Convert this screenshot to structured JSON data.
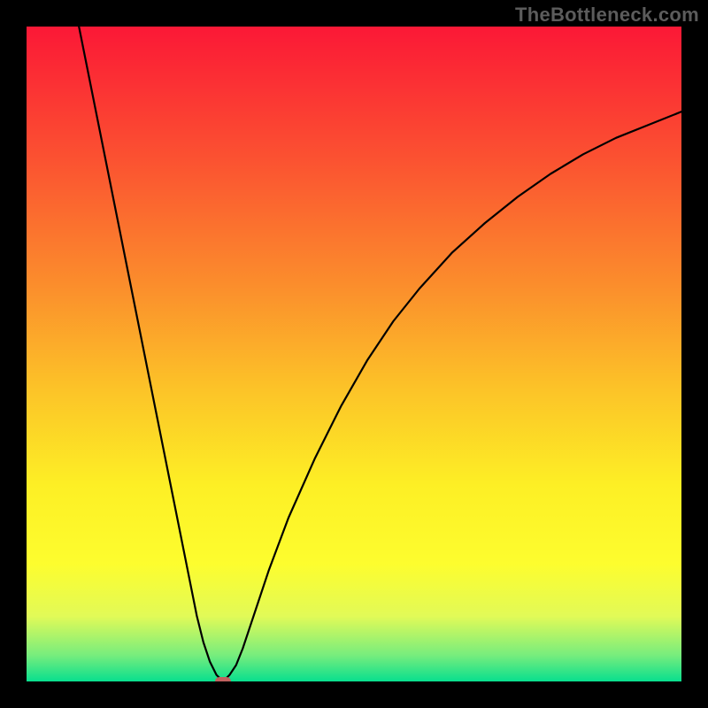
{
  "watermark": "TheBottleneck.com",
  "chart_data": {
    "type": "line",
    "title": "",
    "xlabel": "",
    "ylabel": "",
    "xlim": [
      0,
      100
    ],
    "ylim": [
      0,
      100
    ],
    "grid": false,
    "legend": false,
    "background_gradient": {
      "stops": [
        {
          "offset": 0.0,
          "color": "#fb1836"
        },
        {
          "offset": 0.2,
          "color": "#fb5131"
        },
        {
          "offset": 0.4,
          "color": "#fb8f2c"
        },
        {
          "offset": 0.55,
          "color": "#fcc228"
        },
        {
          "offset": 0.7,
          "color": "#fdef25"
        },
        {
          "offset": 0.82,
          "color": "#fdfd2e"
        },
        {
          "offset": 0.9,
          "color": "#e2fa57"
        },
        {
          "offset": 0.96,
          "color": "#77ed7d"
        },
        {
          "offset": 1.0,
          "color": "#08df8e"
        }
      ]
    },
    "series": [
      {
        "name": "bottleneck-curve",
        "x": [
          8,
          10,
          12,
          14,
          16,
          18,
          20,
          22,
          24,
          26,
          27,
          28,
          29,
          30,
          31,
          32,
          33,
          34,
          35,
          37,
          40,
          44,
          48,
          52,
          56,
          60,
          65,
          70,
          75,
          80,
          85,
          90,
          95,
          100
        ],
        "y": [
          100,
          90,
          80,
          70,
          60,
          50,
          40,
          30,
          20,
          10,
          6,
          3,
          1,
          0,
          1,
          2.5,
          5,
          8,
          11,
          17,
          25,
          34,
          42,
          49,
          55,
          60,
          65.5,
          70,
          74,
          77.5,
          80.5,
          83,
          85,
          87
        ]
      }
    ],
    "annotations": [
      {
        "name": "minimum-marker",
        "x": 30,
        "y": 0,
        "shape": "rounded-rect",
        "color": "#c1615f"
      }
    ]
  }
}
